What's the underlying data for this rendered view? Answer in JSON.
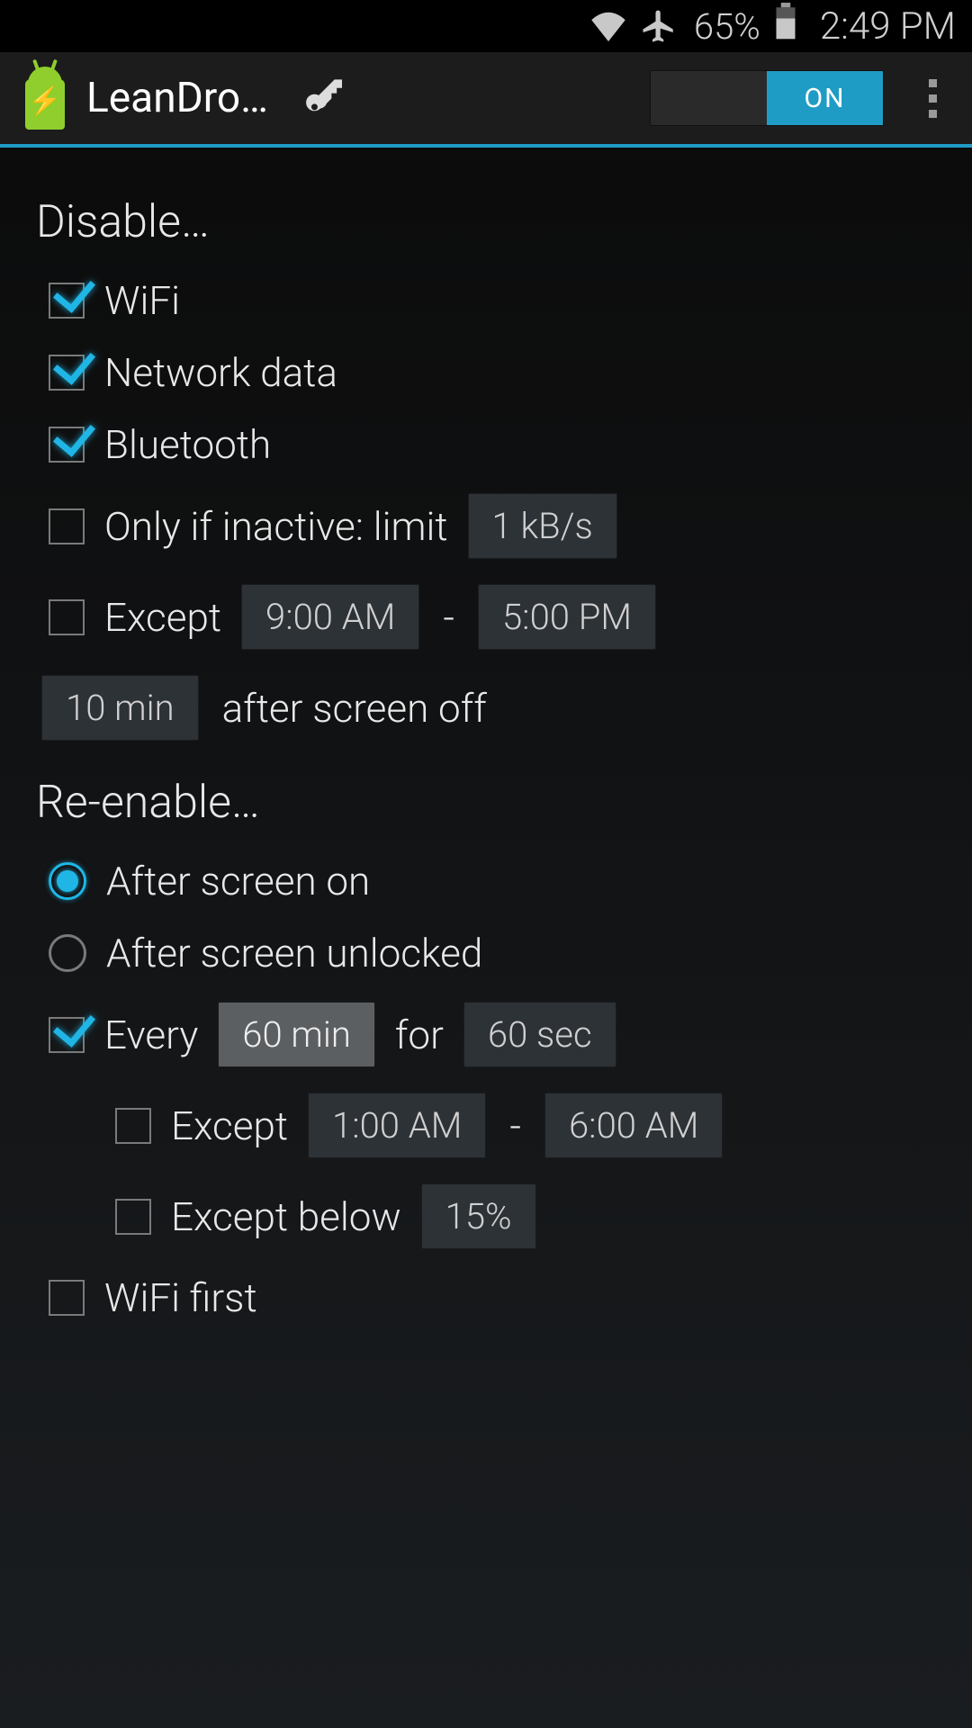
{
  "status_bar": {
    "battery_percent": "65%",
    "time": "2:49 PM"
  },
  "action_bar": {
    "title": "LeanDro…",
    "toggle_on_label": "ON"
  },
  "sections": {
    "disable": {
      "header": "Disable…",
      "wifi": "WiFi",
      "network_data": "Network data",
      "bluetooth": "Bluetooth",
      "only_if_inactive": "Only if inactive: limit",
      "inactive_limit_value": "1 kB/s",
      "except": "Except",
      "except_start": "9:00 AM",
      "except_end": "5:00 PM",
      "delay_value": "10 min",
      "delay_suffix": "after screen off"
    },
    "reenable": {
      "header": "Re-enable…",
      "after_screen_on": "After screen on",
      "after_screen_unlocked": "After screen unlocked",
      "every": "Every",
      "every_interval": "60 min",
      "for": "for",
      "for_duration": "60 sec",
      "except": "Except",
      "except_start": "1:00 AM",
      "except_end": "6:00 AM",
      "except_below": "Except below",
      "except_below_value": "15%",
      "wifi_first": "WiFi first"
    }
  }
}
